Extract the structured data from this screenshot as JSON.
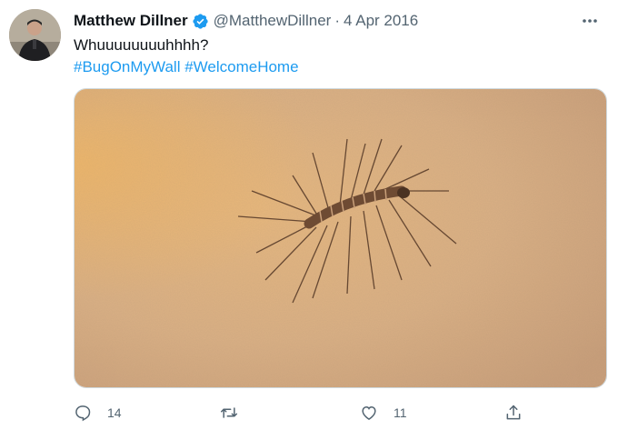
{
  "tweet": {
    "author_name": "Matthew Dillner",
    "handle": "@MatthewDillner",
    "separator": "·",
    "date": "4 Apr 2016",
    "text": "Whuuuuuuuuhhhh?",
    "hashtags": [
      "#BugOnMyWall",
      "#WelcomeHome"
    ],
    "verified": true
  },
  "actions": {
    "reply_count": "14",
    "retweet_count": "",
    "like_count": "11"
  },
  "icons": {
    "verified": "verified-badge-icon",
    "more": "more-dots-icon",
    "reply": "reply-icon",
    "retweet": "retweet-icon",
    "like": "heart-icon",
    "share": "share-icon"
  },
  "colors": {
    "link": "#1d9bf0",
    "secondary_text": "#536471",
    "primary_text": "#0f1419"
  }
}
